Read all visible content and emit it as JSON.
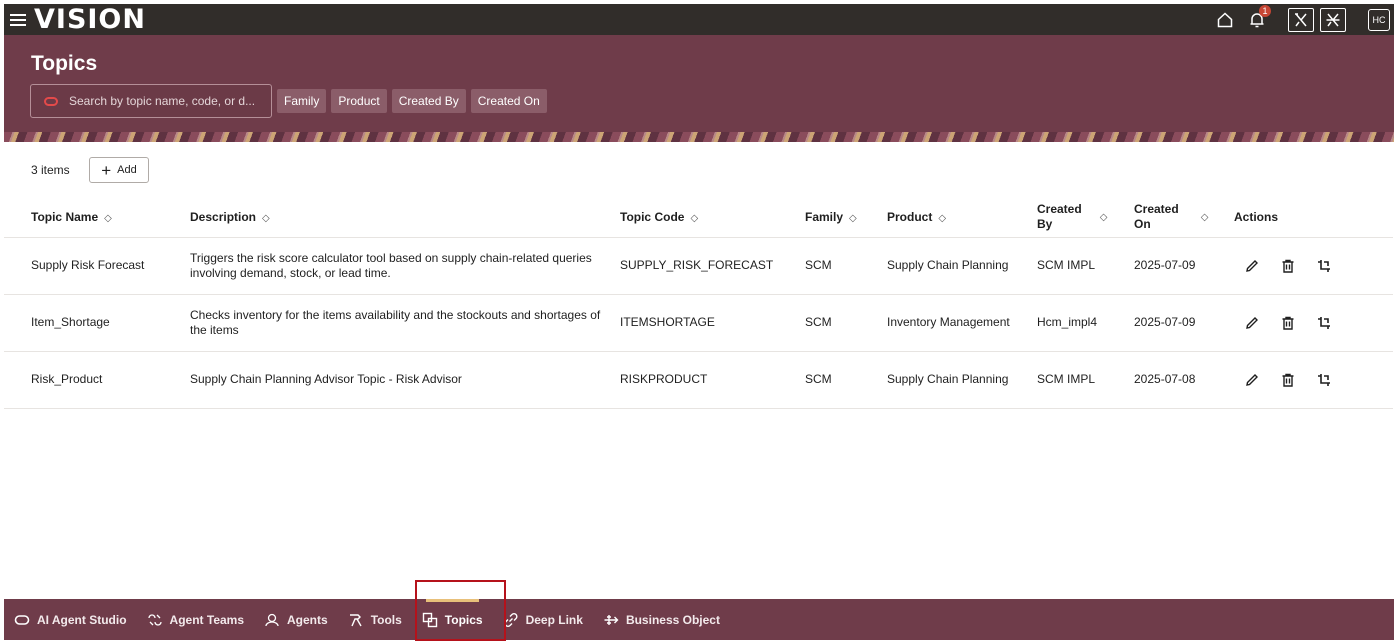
{
  "app": {
    "brand": "VISION"
  },
  "topbar": {
    "notification_count": "1",
    "avatar_initials": "HC"
  },
  "header": {
    "title": "Topics",
    "search_placeholder": "Search by topic name, code, or d...",
    "filters": [
      "Family",
      "Product",
      "Created By",
      "Created On"
    ]
  },
  "toolbar": {
    "count_label": "3 items",
    "add_label": "Add"
  },
  "table": {
    "columns": {
      "name": "Topic Name",
      "description": "Description",
      "code": "Topic Code",
      "family": "Family",
      "product": "Product",
      "created_by_1": "Created",
      "created_by_2": "By",
      "created_on_1": "Created",
      "created_on_2": "On",
      "actions": "Actions"
    },
    "rows": [
      {
        "name": "Supply Risk Forecast",
        "description": "Triggers the risk score calculator tool based on supply chain-related queries involving demand, stock, or lead time.",
        "code": "SUPPLY_RISK_FORECAST",
        "family": "SCM",
        "product": "Supply Chain Planning",
        "created_by": "SCM IMPL",
        "created_on": "2025-07-09"
      },
      {
        "name": "Item_Shortage",
        "description": "Checks inventory for the items availability and the stockouts and shortages of the items",
        "code": "ITEMSHORTAGE",
        "family": "SCM",
        "product": "Inventory Management",
        "created_by": "Hcm_impl4",
        "created_on": "2025-07-09"
      },
      {
        "name": "Risk_Product",
        "description": "Supply Chain Planning Advisor Topic - Risk Advisor",
        "code": "RISKPRODUCT",
        "family": "SCM",
        "product": "Supply Chain Planning",
        "created_by": "SCM IMPL",
        "created_on": "2025-07-08"
      }
    ]
  },
  "bottom_nav": {
    "items": [
      {
        "label": "AI Agent Studio",
        "icon": "oracle-ring-icon"
      },
      {
        "label": "Agent Teams",
        "icon": "agent-teams-icon"
      },
      {
        "label": "Agents",
        "icon": "agents-icon"
      },
      {
        "label": "Tools",
        "icon": "tools-icon"
      },
      {
        "label": "Topics",
        "icon": "topics-icon",
        "active": true
      },
      {
        "label": "Deep Link",
        "icon": "link-icon"
      },
      {
        "label": "Business Object",
        "icon": "business-object-icon"
      }
    ]
  },
  "colors": {
    "topbar": "#312d2a",
    "header": "#6f3c4a",
    "accent_active": "#e8c07a",
    "highlight_box": "#b5121b",
    "badge": "#c74634"
  }
}
